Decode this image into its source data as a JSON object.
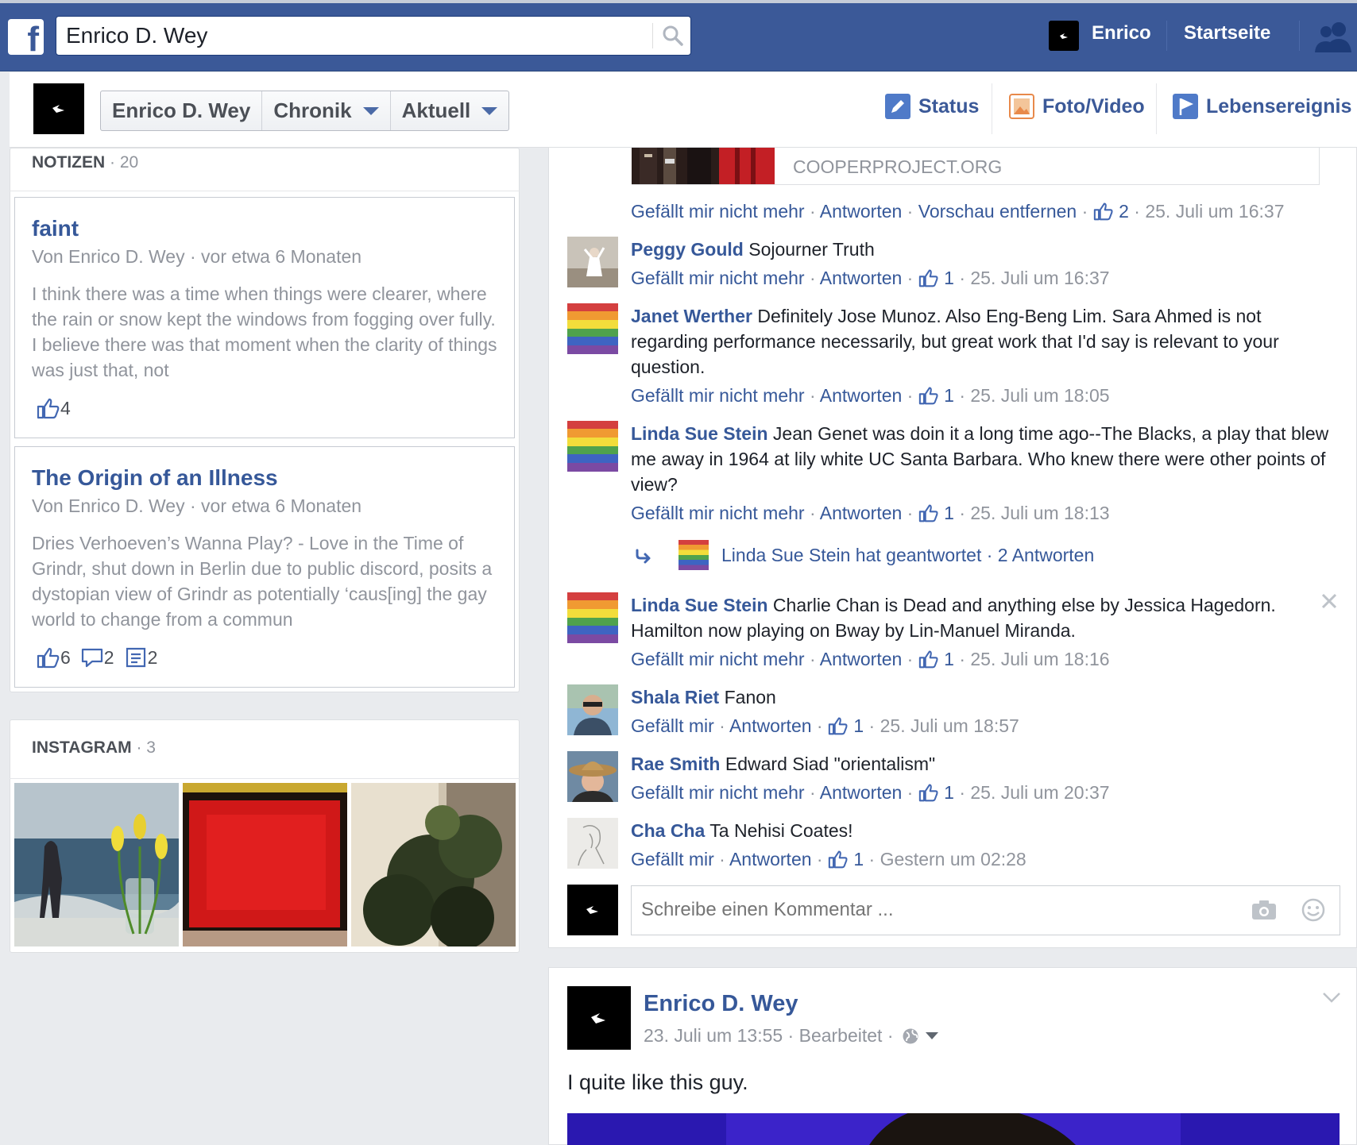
{
  "topbar": {
    "search_value": "Enrico D. Wey",
    "user_name": "Enrico",
    "home_label": "Startseite"
  },
  "profile_nav": {
    "name": "Enrico D. Wey",
    "timeline": "Chronik",
    "current": "Aktuell"
  },
  "composer": {
    "status": "Status",
    "photo": "Foto/Video",
    "life_event": "Lebensereignis"
  },
  "notes": {
    "title": "NOTIZEN",
    "count": "· 20",
    "items": [
      {
        "title": "faint",
        "meta": "Von Enrico D. Wey · vor etwa 6 Monaten",
        "body": "I think there was a time when things were clearer, where the rain or snow kept  the windows from fogging over fully. I believe there was that moment when the clarity of things was just that, not",
        "likes": "4"
      },
      {
        "title": "The Origin of an Illness",
        "meta": "Von Enrico D. Wey · vor etwa 6 Monaten",
        "body": "Dries Verhoeven’s Wanna Play? - Love in the Time of Grindr, shut down in Berlin due to public discord, posits a dystopian view of Grindr as potentially ‘caus[ing] the gay world to change from a commun",
        "likes": "6",
        "comments": "2",
        "shares": "2"
      }
    ]
  },
  "instagram": {
    "title": "INSTAGRAM",
    "count": "· 3"
  },
  "feed": {
    "link_domain": "COOPERPROJECT.ORG",
    "link_actions": {
      "unlike": "Gefällt mir nicht mehr",
      "reply": "Antworten",
      "remove_preview": "Vorschau entfernen",
      "likes": "2",
      "time": "25. Juli um 16:37"
    },
    "comments": [
      {
        "author": "Peggy Gould",
        "text": " Sojourner Truth",
        "like_label": "Gefällt mir nicht mehr",
        "reply": "Antworten",
        "likes": "1",
        "time": "25. Juli um 16:37"
      },
      {
        "author": "Janet Werther",
        "text": " Definitely Jose Munoz. Also Eng-Beng Lim. Sara Ahmed is not regarding performance necessarily, but great work that I'd say is relevant to your question.",
        "like_label": "Gefällt mir nicht mehr",
        "reply": "Antworten",
        "likes": "1",
        "time": "25. Juli um 18:05"
      },
      {
        "author": "Linda Sue Stein",
        "text": " Jean Genet was doin it a long time ago--The Blacks, a play that blew me away in 1964 at lily white UC Santa Barbara. Who knew there were other points of view?",
        "like_label": "Gefällt mir nicht mehr",
        "reply": "Antworten",
        "likes": "1",
        "time": "25. Juli um 18:13"
      },
      {
        "author": "Linda Sue Stein",
        "text": " Charlie Chan is Dead and anything else by Jessica Hagedorn. Hamilton now playing on Bway by Lin-Manuel Miranda.",
        "like_label": "Gefällt mir nicht mehr",
        "reply": "Antworten",
        "likes": "1",
        "time": "25. Juli um 18:16"
      },
      {
        "author": "Shala Riet",
        "text": " Fanon",
        "like_label": "Gefällt mir",
        "reply": "Antworten",
        "likes": "1",
        "time": "25. Juli um 18:57"
      },
      {
        "author": "Rae Smith",
        "text": " Edward Siad \"orientalism\"",
        "like_label": "Gefällt mir nicht mehr",
        "reply": "Antworten",
        "likes": "1",
        "time": "25. Juli um 20:37"
      },
      {
        "author": "Cha Cha",
        "text": " Ta Nehisi Coates!",
        "like_label": "Gefällt mir",
        "reply": "Antworten",
        "likes": "1",
        "time": "Gestern um 02:28"
      }
    ],
    "reply_summary": {
      "text": "Linda Sue Stein hat geantwortet",
      "count": "· 2 Antworten"
    },
    "write_placeholder": "Schreibe einen Kommentar ..."
  },
  "post2": {
    "author": "Enrico D. Wey",
    "meta": "23. Juli um 13:55 · Bearbeitet ·",
    "text": "I quite like this guy."
  }
}
